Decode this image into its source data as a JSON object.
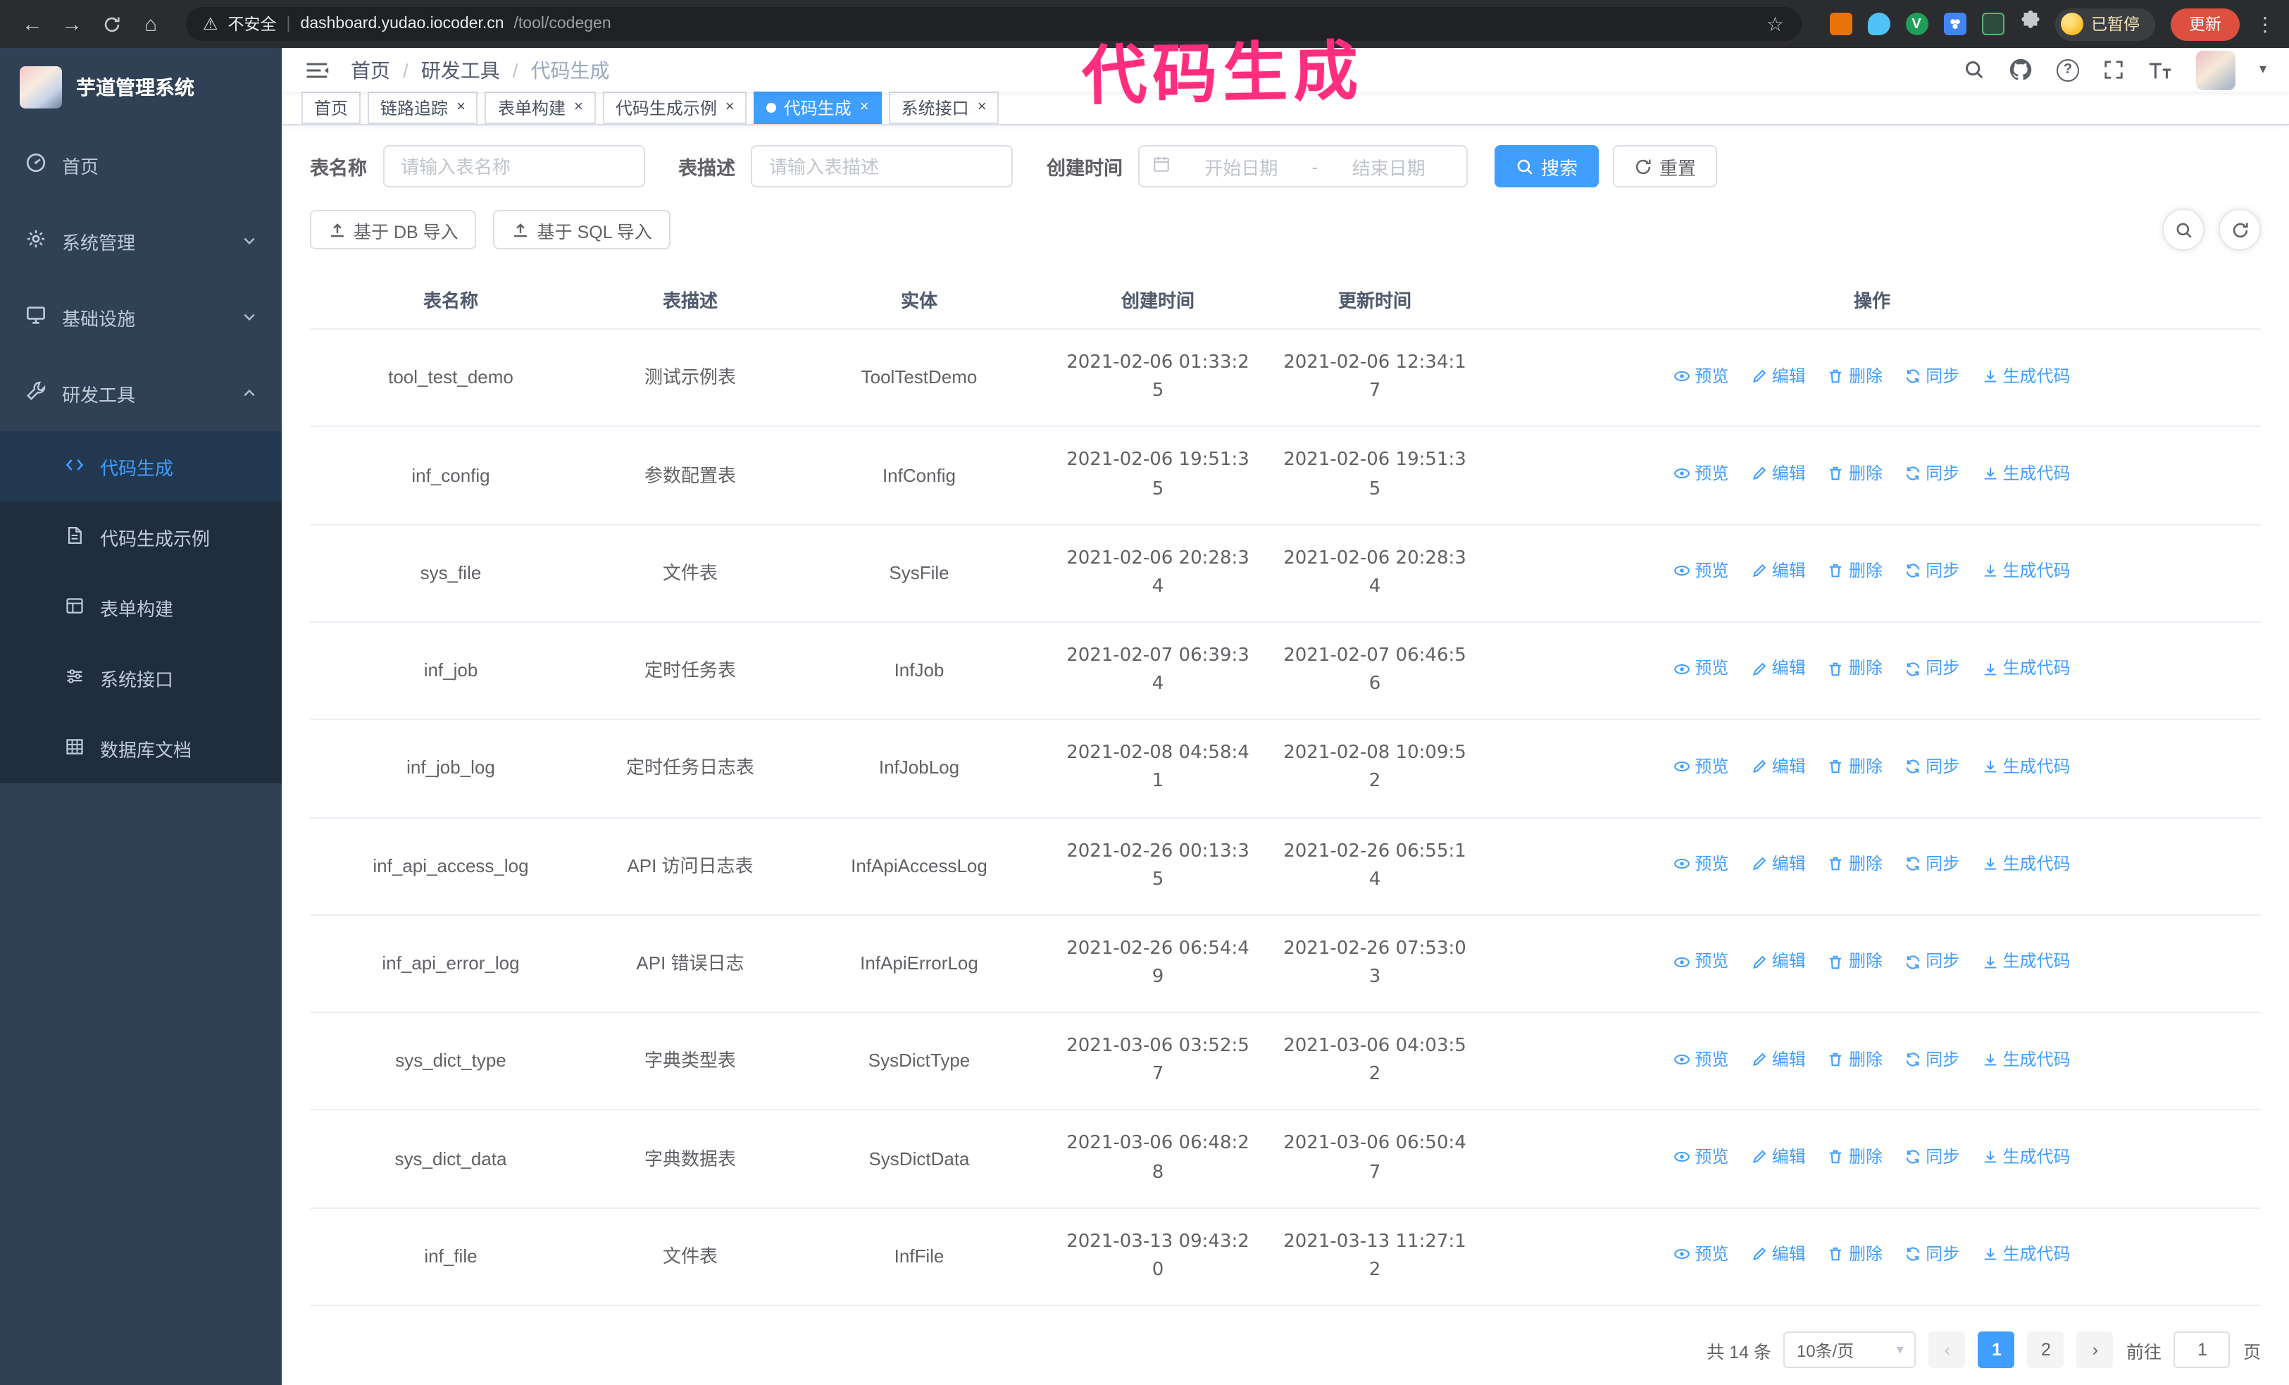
{
  "annotation": {
    "text": "代码生成"
  },
  "colors": {
    "accent": "#409eff",
    "annotation_pink": "#ff2d7d",
    "sidebar_bg": "#304156",
    "submenu_bg": "#1f2d3d",
    "update_button_bg": "#dd4f3e"
  },
  "icons": {
    "back": "←",
    "forward": "→",
    "home": "⌂",
    "star": "☆",
    "warning": "⚠",
    "kebab": "⋮",
    "caret_down": "▾",
    "close": "×",
    "arrow_left": "‹",
    "arrow_right": "›"
  },
  "browser": {
    "security_label": "不安全",
    "url_host": "dashboard.yudao.iocoder.cn",
    "url_path": "/tool/codegen",
    "profile_badge": "已暂停",
    "update_button": "更新"
  },
  "sidebar": {
    "app_title": "芋道管理系统",
    "items": [
      {
        "label": "首页"
      },
      {
        "label": "系统管理"
      },
      {
        "label": "基础设施"
      },
      {
        "label": "研发工具"
      }
    ],
    "sub_items": [
      {
        "label": "代码生成"
      },
      {
        "label": "代码生成示例"
      },
      {
        "label": "表单构建"
      },
      {
        "label": "系统接口"
      },
      {
        "label": "数据库文档"
      }
    ]
  },
  "topbar": {
    "breadcrumb": [
      {
        "label": "首页"
      },
      {
        "label": "研发工具"
      },
      {
        "label": "代码生成"
      }
    ]
  },
  "tabs": [
    {
      "label": "首页"
    },
    {
      "label": "链路追踪"
    },
    {
      "label": "表单构建"
    },
    {
      "label": "代码生成示例"
    },
    {
      "label": "代码生成"
    },
    {
      "label": "系统接口"
    }
  ],
  "filters": {
    "table_name_label": "表名称",
    "table_name_placeholder": "请输入表名称",
    "table_desc_label": "表描述",
    "table_desc_placeholder": "请输入表描述",
    "create_time_label": "创建时间",
    "date_start_placeholder": "开始日期",
    "date_separator": "-",
    "date_end_placeholder": "结束日期",
    "search_button": "搜索",
    "reset_button": "重置"
  },
  "toolbar": {
    "import_db_button": "基于 DB 导入",
    "import_sql_button": "基于 SQL 导入"
  },
  "table": {
    "columns": [
      "表名称",
      "表描述",
      "实体",
      "创建时间",
      "更新时间",
      "操作"
    ],
    "action_labels": [
      "预览",
      "编辑",
      "删除",
      "同步",
      "生成代码"
    ],
    "rows": [
      {
        "name": "tool_test_demo",
        "desc": "测试示例表",
        "entity": "ToolTestDemo",
        "created": "2021-02-06 01:33:25",
        "updated": "2021-02-06 12:34:17"
      },
      {
        "name": "inf_config",
        "desc": "参数配置表",
        "entity": "InfConfig",
        "created": "2021-02-06 19:51:35",
        "updated": "2021-02-06 19:51:35"
      },
      {
        "name": "sys_file",
        "desc": "文件表",
        "entity": "SysFile",
        "created": "2021-02-06 20:28:34",
        "updated": "2021-02-06 20:28:34"
      },
      {
        "name": "inf_job",
        "desc": "定时任务表",
        "entity": "InfJob",
        "created": "2021-02-07 06:39:34",
        "updated": "2021-02-07 06:46:56"
      },
      {
        "name": "inf_job_log",
        "desc": "定时任务日志表",
        "entity": "InfJobLog",
        "created": "2021-02-08 04:58:41",
        "updated": "2021-02-08 10:09:52"
      },
      {
        "name": "inf_api_access_log",
        "desc": "API 访问日志表",
        "entity": "InfApiAccessLog",
        "created": "2021-02-26 00:13:35",
        "updated": "2021-02-26 06:55:14"
      },
      {
        "name": "inf_api_error_log",
        "desc": "API 错误日志",
        "entity": "InfApiErrorLog",
        "created": "2021-02-26 06:54:49",
        "updated": "2021-02-26 07:53:03"
      },
      {
        "name": "sys_dict_type",
        "desc": "字典类型表",
        "entity": "SysDictType",
        "created": "2021-03-06 03:52:57",
        "updated": "2021-03-06 04:03:52"
      },
      {
        "name": "sys_dict_data",
        "desc": "字典数据表",
        "entity": "SysDictData",
        "created": "2021-03-06 06:48:28",
        "updated": "2021-03-06 06:50:47"
      },
      {
        "name": "inf_file",
        "desc": "文件表",
        "entity": "InfFile",
        "created": "2021-03-13 09:43:20",
        "updated": "2021-03-13 11:27:12"
      }
    ]
  },
  "pagination": {
    "total_text": "共 14 条",
    "page_size": "10条/页",
    "pages": [
      "1",
      "2"
    ],
    "goto_label": "前往",
    "goto_value": "1",
    "goto_unit": "页"
  }
}
